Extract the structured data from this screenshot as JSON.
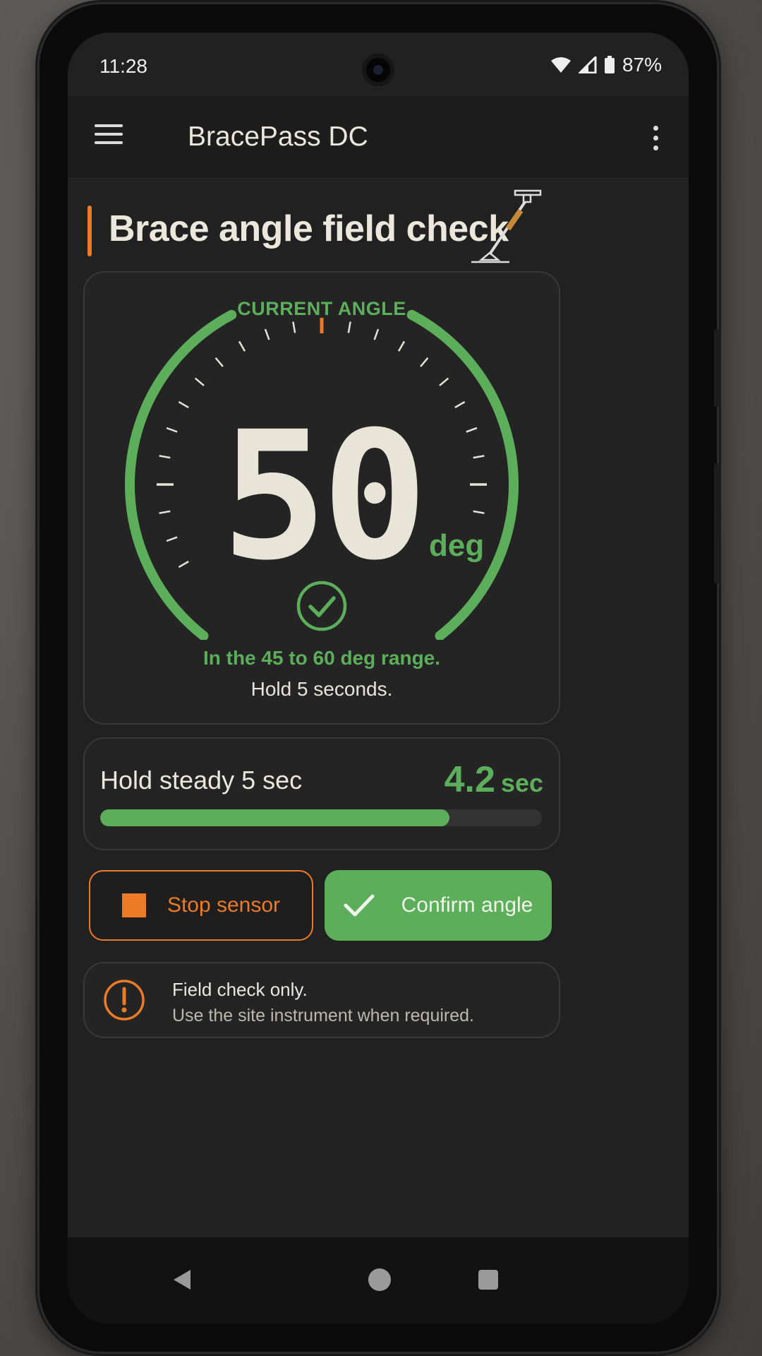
{
  "status_bar": {
    "time": "11:28",
    "battery": "87%"
  },
  "app_bar": {
    "title": "BracePass DC"
  },
  "page": {
    "title": "Brace angle field check"
  },
  "gauge": {
    "label": "CURRENT ANGLE",
    "value": "50",
    "unit": "deg",
    "range_message": "In the 45 to 60 deg range.",
    "hold_message": "Hold 5 seconds."
  },
  "hold": {
    "label": "Hold steady 5 sec",
    "elapsed": "4.2",
    "unit": "sec",
    "progress_fraction": 0.79
  },
  "buttons": {
    "stop": "Stop sensor",
    "confirm": "Confirm angle"
  },
  "notice": {
    "line1": "Field check only.",
    "line2": "Use the site instrument when required."
  },
  "colors": {
    "accent_orange": "#ec7a26",
    "ok_green": "#5cae5b",
    "text_light": "#ece7dc",
    "background": "#212121"
  }
}
